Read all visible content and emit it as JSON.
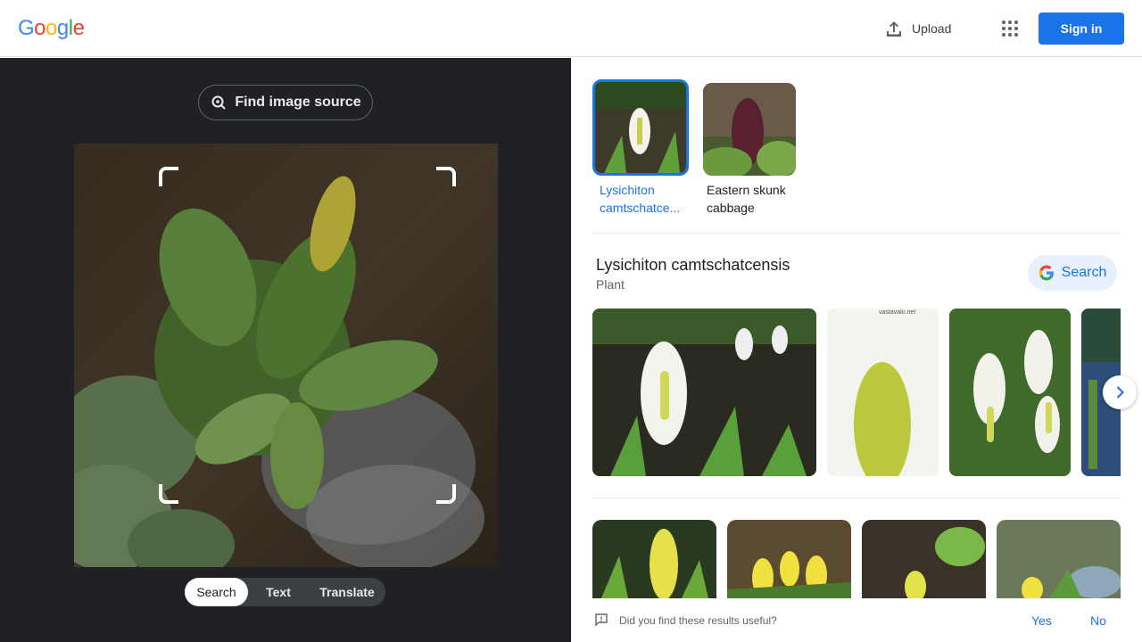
{
  "header": {
    "logo_letters": [
      "G",
      "o",
      "o",
      "g",
      "l",
      "e"
    ],
    "upload_label": "Upload",
    "signin_label": "Sign in",
    "accent": "#1a73e8"
  },
  "left_panel": {
    "find_source_label": "Find image source",
    "modes": [
      "Search",
      "Text",
      "Translate"
    ],
    "active_mode": "Search"
  },
  "results": {
    "thumbnails": [
      {
        "label": "Lysichiton camtschatce...",
        "selected": true
      },
      {
        "label": "Eastern skunk cabbage",
        "selected": false
      }
    ],
    "entity": {
      "title": "Lysichiton camtschatcensis",
      "subtitle": "Plant",
      "search_label": "Search"
    },
    "gallery_watermark": "vastavalo.net",
    "feedback": {
      "question": "Did you find these results useful?",
      "yes": "Yes",
      "no": "No"
    }
  }
}
